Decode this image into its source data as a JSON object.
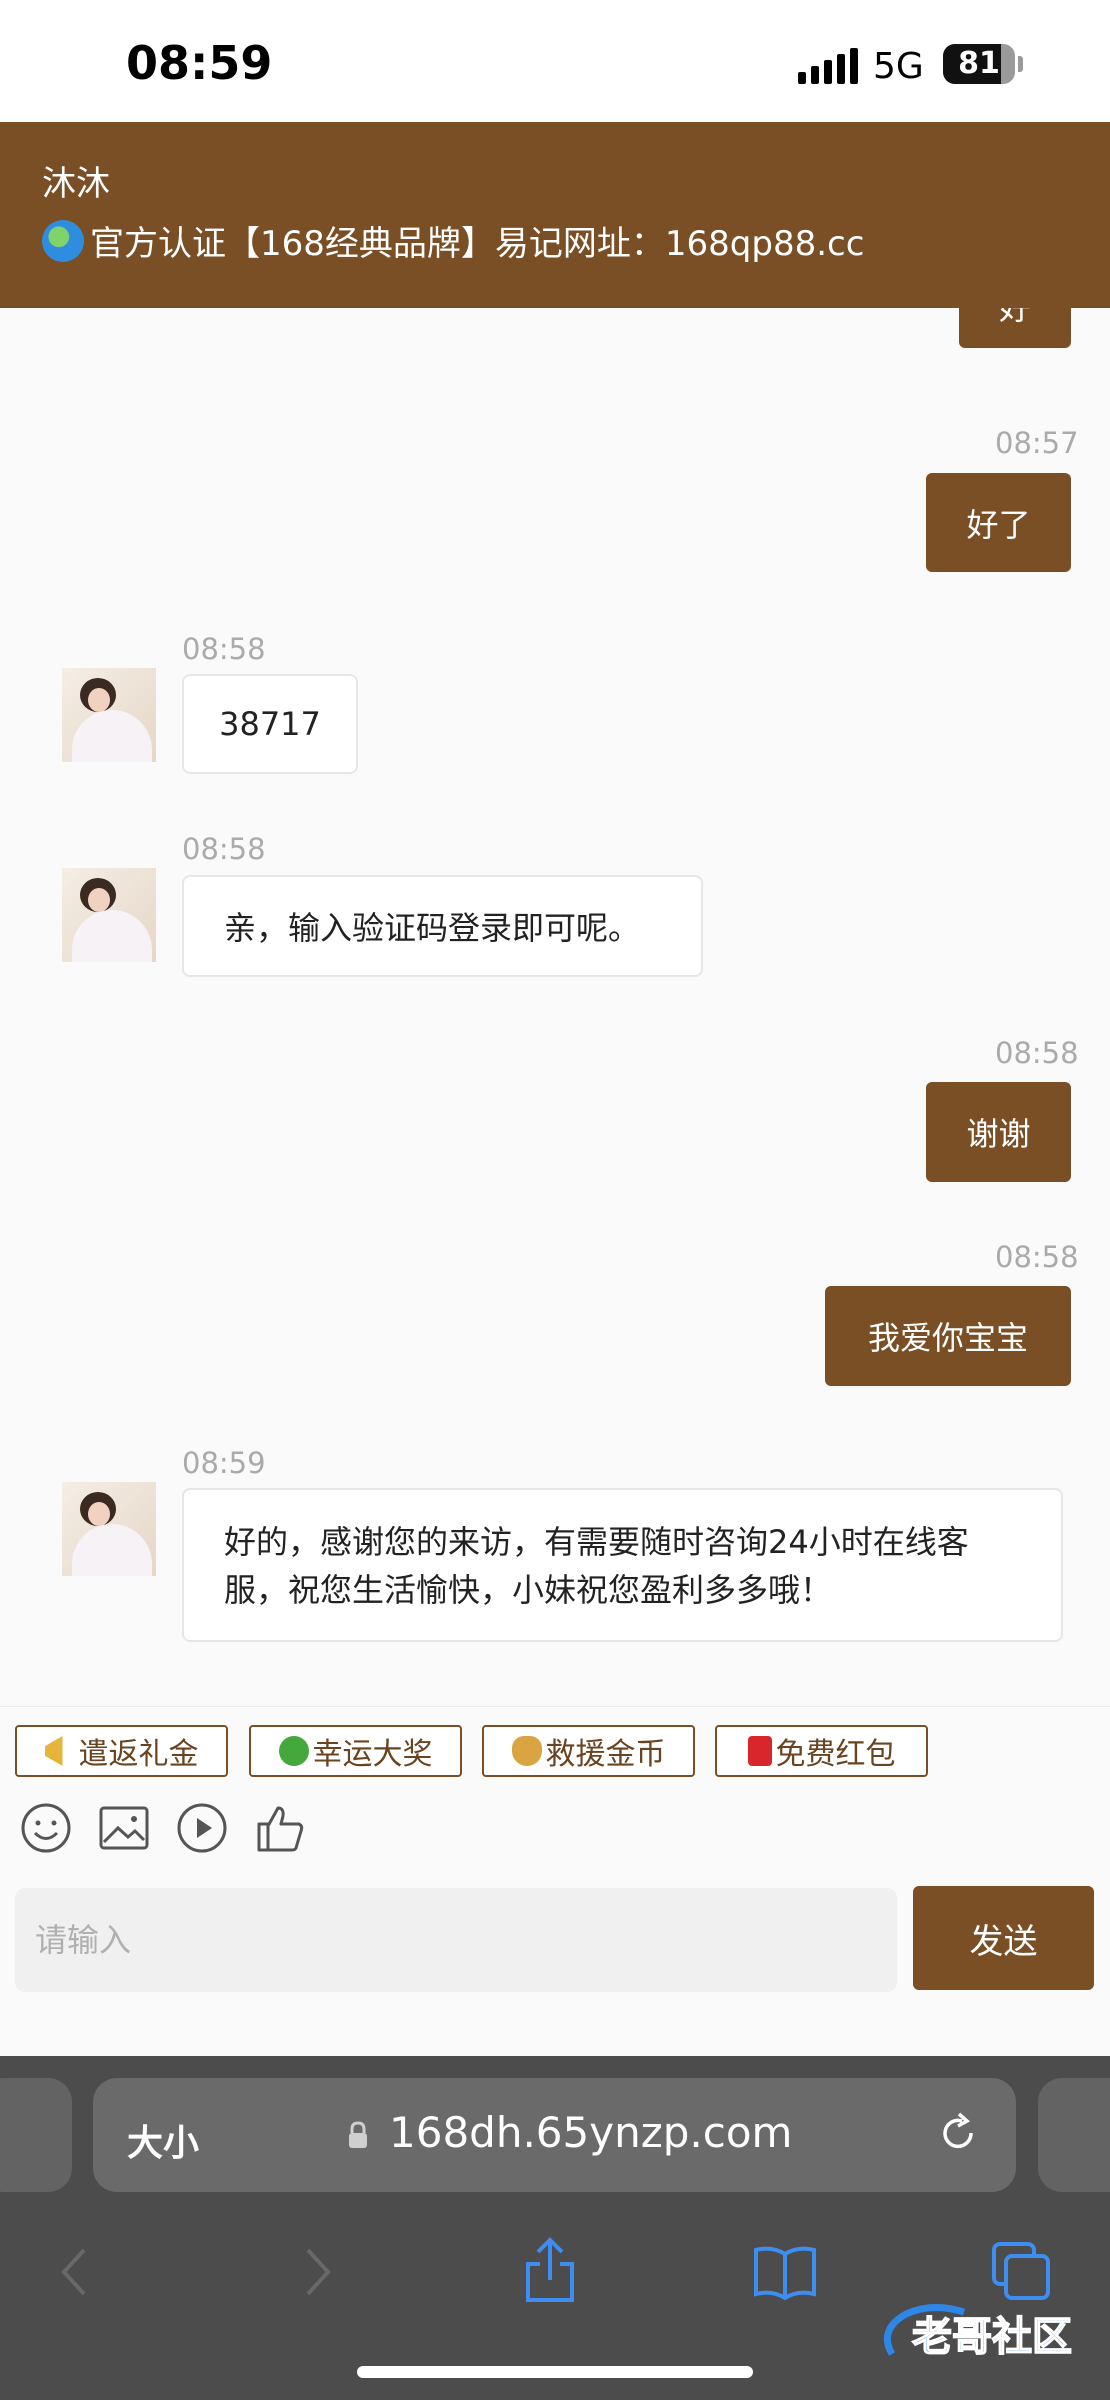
{
  "status_bar": {
    "time": "08:59",
    "network": "5G",
    "battery": "81",
    "battery_level_percent": 81
  },
  "header": {
    "name": "沐沐",
    "notice": "官方认证【168经典品牌】易记网址：168qp88.cc"
  },
  "messages": [
    {
      "side": "out",
      "time": "",
      "text": "好"
    },
    {
      "side": "out",
      "time": "08:57",
      "text": "好了"
    },
    {
      "side": "in",
      "time": "08:58",
      "text": "38717"
    },
    {
      "side": "in",
      "time": "08:58",
      "text": "亲，输入验证码登录即可呢。"
    },
    {
      "side": "out",
      "time": "08:58",
      "text": "谢谢"
    },
    {
      "side": "out",
      "time": "08:58",
      "text": "我爱你宝宝"
    },
    {
      "side": "in",
      "time": "08:59",
      "text": "好的，感谢您的来访，有需要随时咨询24小时在线客服，祝您生活愉快，小妹祝您盈利多多哦！"
    }
  ],
  "quick_actions": [
    {
      "label": "遣返礼金",
      "icon": "megaphone-icon"
    },
    {
      "label": "幸运大奖",
      "icon": "clover-icon"
    },
    {
      "label": "救援金币",
      "icon": "money-bag-icon"
    },
    {
      "label": "免费红包",
      "icon": "red-envelope-icon"
    }
  ],
  "toolbar": {
    "icons": [
      "emoji-icon",
      "image-icon",
      "video-icon",
      "thumbs-up-icon"
    ]
  },
  "input": {
    "placeholder": "请输入",
    "value": ""
  },
  "send_label": "发送",
  "browser": {
    "text_size_label": "大小",
    "url": "168dh.65ynzp.com"
  },
  "watermark": "老哥社区",
  "colors": {
    "brand": "#7a4f25",
    "background": "#fafafa",
    "browser_chrome": "#4c4c4c",
    "link_blue": "#3d8ef0"
  }
}
